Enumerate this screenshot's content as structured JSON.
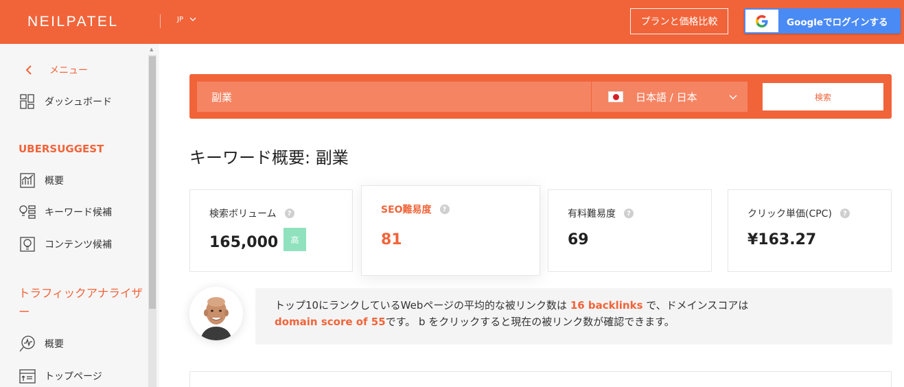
{
  "header": {
    "logo": "NEILPATEL",
    "language": "JP",
    "plan_button": "プランと価格比較",
    "google_button": "Googleでログインする"
  },
  "sidebar": {
    "menu_label": "メニュー",
    "dashboard": "ダッシュボード",
    "section_ubersuggest": "UBERSUGGEST",
    "overview": "概要",
    "keyword_ideas": "キーワード候補",
    "content_ideas": "コンテンツ候補",
    "section_traffic": "トラフィックアナライザー",
    "traffic_overview": "概要",
    "top_pages": "トップページ"
  },
  "search": {
    "keyword": "副業",
    "language": "日本語 / 日本",
    "button": "検索"
  },
  "page": {
    "title": "キーワード概要: 副業"
  },
  "metrics": {
    "volume": {
      "label": "検索ボリューム",
      "value": "165,000",
      "badge": "高"
    },
    "seo": {
      "label": "SEO難易度",
      "value": "81"
    },
    "paid": {
      "label": "有料難易度",
      "value": "69"
    },
    "cpc": {
      "label": "クリック単価(CPC)",
      "value": "¥163.27"
    },
    "help": "?"
  },
  "info": {
    "part1": "トップ10にランクしているWebページの平均的な被リンク数は ",
    "backlinks": "16 backlinks",
    "part2": " で、ドメインスコアは",
    "domain_score": "domain score of 55",
    "part3": "です。 b をクリックすると現在の被リンク数が確認できます。"
  },
  "colors": {
    "brand": "#f1643a",
    "google": "#4a8af4",
    "badge": "#8fe2bd"
  }
}
